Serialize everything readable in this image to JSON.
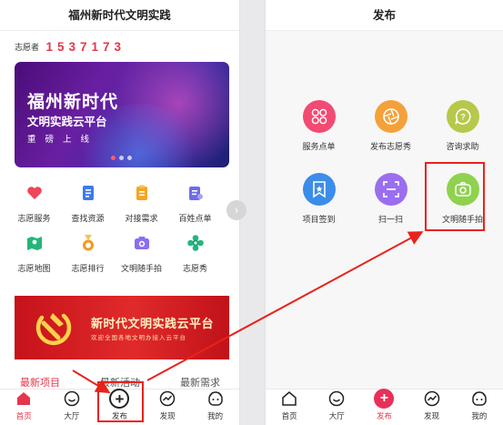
{
  "left_screen": {
    "title": "福州新时代文明实践",
    "counter": {
      "label": "志愿者",
      "digits": [
        "1",
        "5",
        "3",
        "7",
        "1",
        "7",
        "3"
      ]
    },
    "hero": {
      "line1": "福州新时代",
      "line2": "文明实践云平台",
      "line3": "重磅上线"
    },
    "services": [
      {
        "label": "志愿服务",
        "icon": "heart-icon",
        "color": "#f0445a"
      },
      {
        "label": "查找资源",
        "icon": "document-icon",
        "color": "#3d7be8"
      },
      {
        "label": "对接需求",
        "icon": "clipboard-icon",
        "color": "#f3a622"
      },
      {
        "label": "百姓点单",
        "icon": "user-card-icon",
        "color": "#6f6ce8"
      },
      {
        "label": "志愿地图",
        "icon": "map-icon",
        "color": "#23b67a"
      },
      {
        "label": "志愿排行",
        "icon": "medal-icon",
        "color": "#f39a1e"
      },
      {
        "label": "文明随手拍",
        "icon": "camera-icon",
        "color": "#8a6ef0"
      },
      {
        "label": "志愿秀",
        "icon": "flower-icon",
        "color": "#24b67f"
      }
    ],
    "party_banner": {
      "title": "新时代文明实践云平台",
      "subtitle": "欢迎全国各地文明办接入云平台"
    },
    "content_tabs": [
      "最新项目",
      "最新活动",
      "最新需求"
    ]
  },
  "right_screen": {
    "title": "发布",
    "publish_items": [
      {
        "label": "服务点单",
        "icon": "grid-icon",
        "color": "#f24a72"
      },
      {
        "label": "发布志愿秀",
        "icon": "aperture-icon",
        "color": "#f5a13a"
      },
      {
        "label": "咨询求助",
        "icon": "chat-icon",
        "color": "#b7c84a"
      },
      {
        "label": "项目签到",
        "icon": "bookmark-icon",
        "color": "#3b8de8"
      },
      {
        "label": "扫一扫",
        "icon": "scan-icon",
        "color": "#9b6ef0"
      },
      {
        "label": "文明随手拍",
        "icon": "camera-icon",
        "color": "#8ed24e"
      }
    ]
  },
  "nav": [
    {
      "label": "首页",
      "icon": "home-icon"
    },
    {
      "label": "大厅",
      "icon": "smile-icon"
    },
    {
      "label": "发布",
      "icon": "plus-icon"
    },
    {
      "label": "发现",
      "icon": "trend-icon"
    },
    {
      "label": "我的",
      "icon": "face-icon"
    }
  ],
  "colors": {
    "accent": "#e6354b",
    "annotation": "#e8231b"
  }
}
